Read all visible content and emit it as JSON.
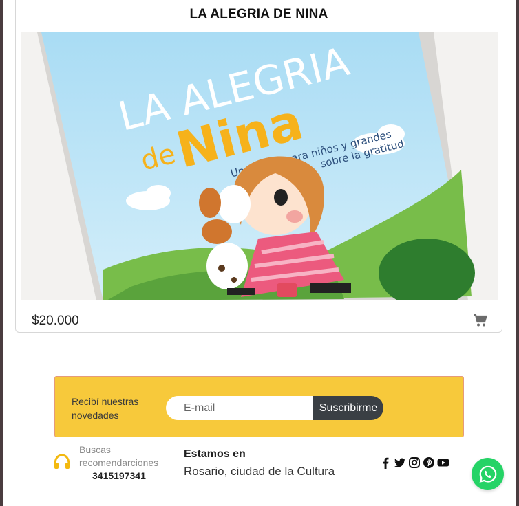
{
  "product": {
    "title": "LA ALEGRIA DE NINA",
    "price": "$20.000",
    "cover_title_line1": "LA ALEGRIA",
    "cover_title_line2_prefix": "de",
    "cover_title_line2": "Nina",
    "cover_subtitle_line1": "Un cuento para niños y grandes",
    "cover_subtitle_line2": "sobre la gratitud"
  },
  "newsletter": {
    "text": "Recibí nuestras novedades",
    "email_placeholder": "E-mail",
    "subscribe_label": "Suscribirme",
    "background_color": "#f7c93b"
  },
  "contact": {
    "label": "Buscas recomendarciones",
    "phone": "3415197341",
    "icon": "headset-icon"
  },
  "location": {
    "title": "Estamos en",
    "text": "Rosario, ciudad de la Cultura"
  },
  "social": {
    "icons": [
      "facebook-icon",
      "twitter-icon",
      "instagram-icon",
      "pinterest-icon",
      "youtube-icon"
    ]
  },
  "whatsapp": {
    "icon": "whatsapp-icon",
    "color": "#25d366"
  },
  "cart": {
    "icon": "shopping-cart-icon"
  }
}
